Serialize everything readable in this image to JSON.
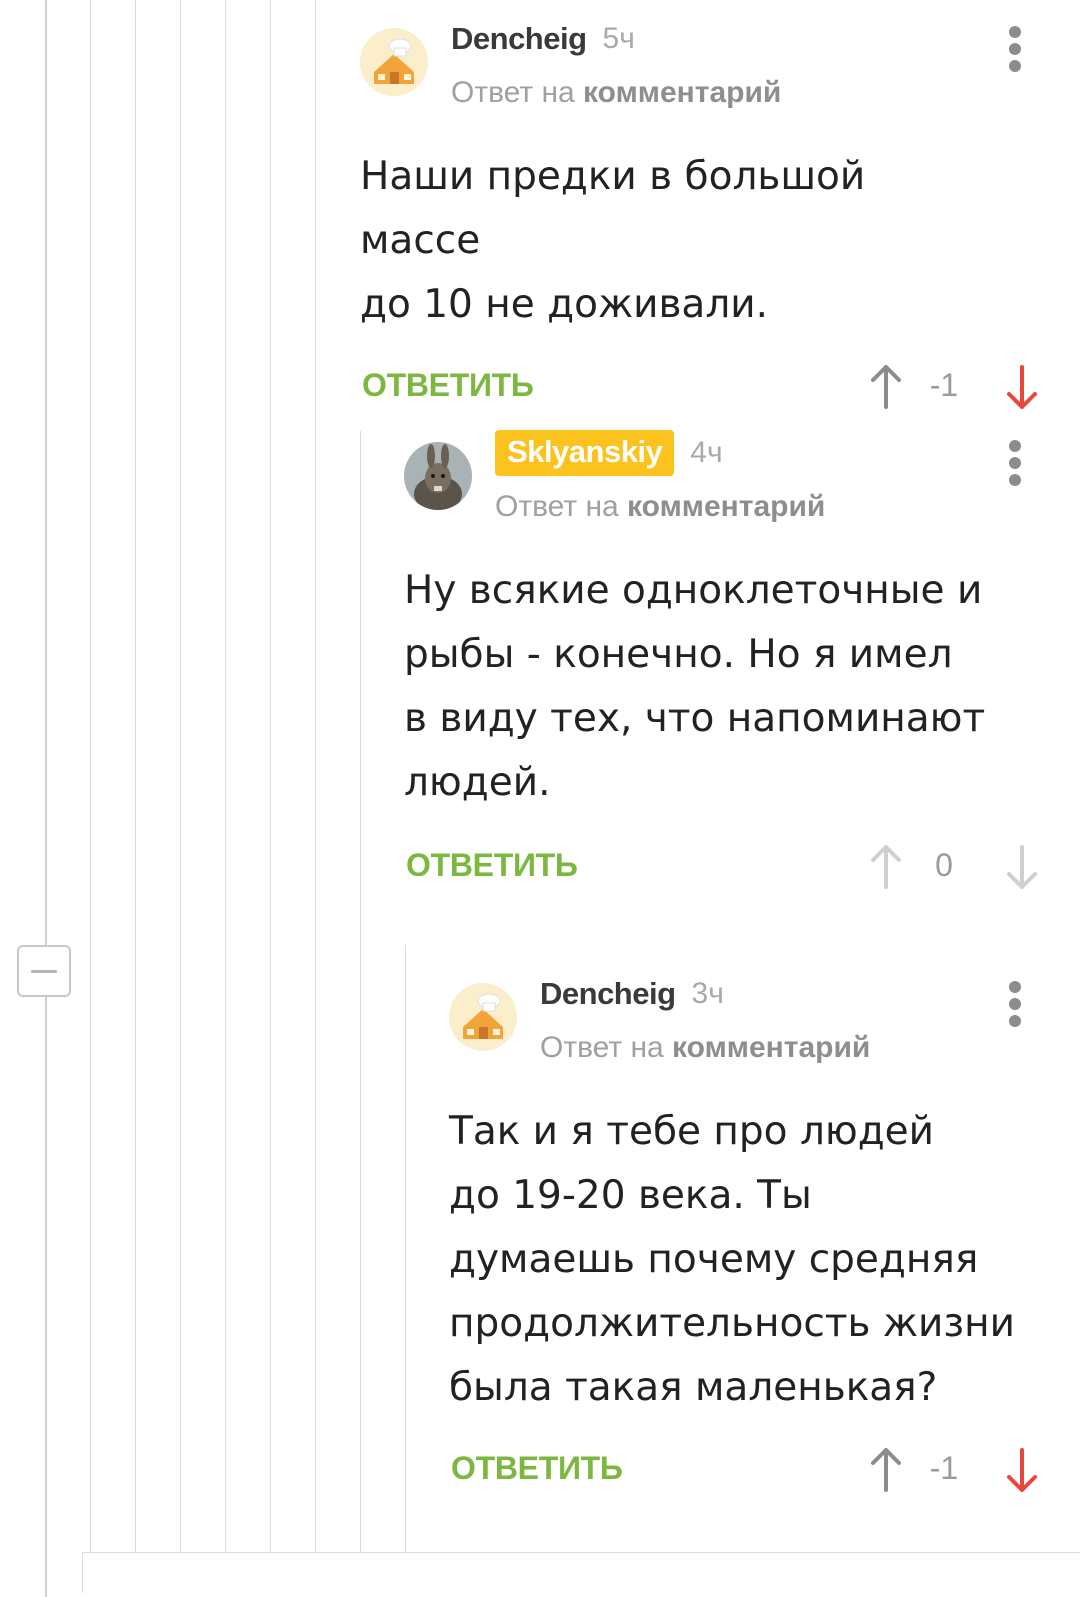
{
  "colors": {
    "accent_green": "#7cb73f",
    "downvote_red": "#e8483a",
    "badge_yellow": "#fcc31e",
    "icon_gray": "#8c8c8c"
  },
  "thread": {
    "collapse_icon": "minus-icon"
  },
  "comments": [
    {
      "author": "Dencheig",
      "time": "5ч",
      "reply_prefix": "Ответ на",
      "reply_link": "комментарий",
      "body": "Наши предки в большой массе\nдо 10 не доживали.",
      "reply_label": "ОТВЕТИТЬ",
      "rating": "-1",
      "avatar_icon": "chef-house-icon",
      "downvoted": true
    },
    {
      "author": "Sklyanskiy",
      "time": "4ч",
      "reply_prefix": "Ответ на",
      "reply_link": "комментарий",
      "body": "Ну всякие одноклеточные и\nрыбы - конечно. Но я имел\nв виду тех, что напоминают\nлюдей.",
      "reply_label": "ОТВЕТИТЬ",
      "rating": "0",
      "avatar_icon": "rabbit-photo-icon",
      "downvoted": false
    },
    {
      "author": "Dencheig",
      "time": "3ч",
      "reply_prefix": "Ответ на",
      "reply_link": "комментарий",
      "body": "Так и я тебе про людей\nдо 19-20 века. Ты\nдумаешь почему средняя\nпродолжительность жизни\nбыла такая маленькая?",
      "reply_label": "ОТВЕТИТЬ",
      "rating": "-1",
      "avatar_icon": "chef-house-icon",
      "downvoted": true
    }
  ]
}
